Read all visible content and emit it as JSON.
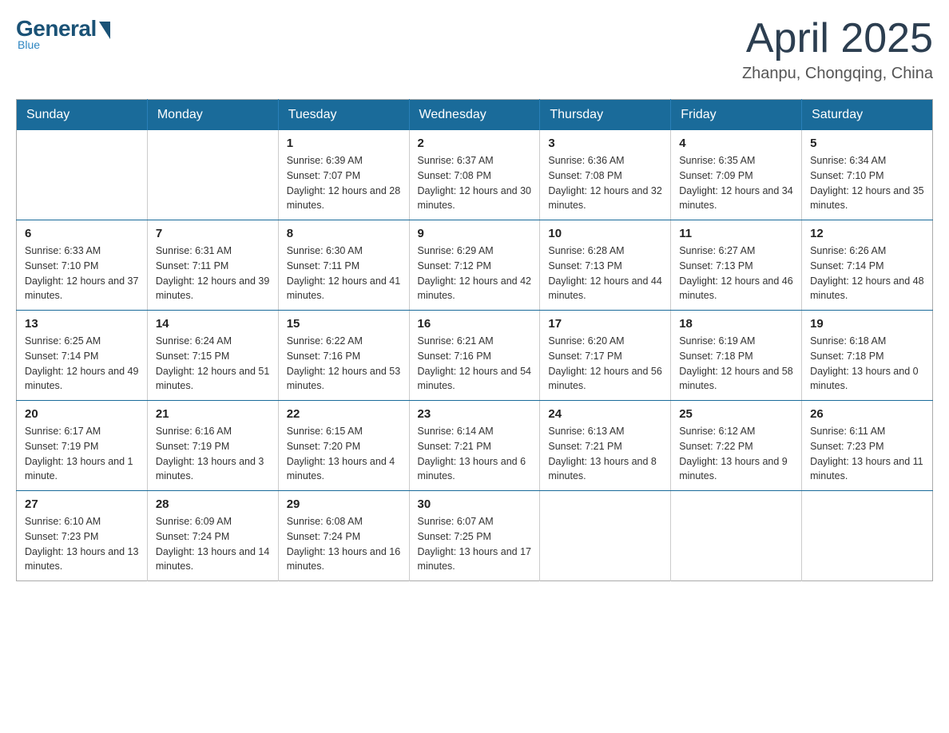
{
  "logo": {
    "general": "General",
    "blue": "Blue",
    "tagline": "Blue"
  },
  "header": {
    "title": "April 2025",
    "location": "Zhanpu, Chongqing, China"
  },
  "days_of_week": [
    "Sunday",
    "Monday",
    "Tuesday",
    "Wednesday",
    "Thursday",
    "Friday",
    "Saturday"
  ],
  "weeks": [
    [
      {
        "day": "",
        "sunrise": "",
        "sunset": "",
        "daylight": ""
      },
      {
        "day": "",
        "sunrise": "",
        "sunset": "",
        "daylight": ""
      },
      {
        "day": "1",
        "sunrise": "Sunrise: 6:39 AM",
        "sunset": "Sunset: 7:07 PM",
        "daylight": "Daylight: 12 hours and 28 minutes."
      },
      {
        "day": "2",
        "sunrise": "Sunrise: 6:37 AM",
        "sunset": "Sunset: 7:08 PM",
        "daylight": "Daylight: 12 hours and 30 minutes."
      },
      {
        "day": "3",
        "sunrise": "Sunrise: 6:36 AM",
        "sunset": "Sunset: 7:08 PM",
        "daylight": "Daylight: 12 hours and 32 minutes."
      },
      {
        "day": "4",
        "sunrise": "Sunrise: 6:35 AM",
        "sunset": "Sunset: 7:09 PM",
        "daylight": "Daylight: 12 hours and 34 minutes."
      },
      {
        "day": "5",
        "sunrise": "Sunrise: 6:34 AM",
        "sunset": "Sunset: 7:10 PM",
        "daylight": "Daylight: 12 hours and 35 minutes."
      }
    ],
    [
      {
        "day": "6",
        "sunrise": "Sunrise: 6:33 AM",
        "sunset": "Sunset: 7:10 PM",
        "daylight": "Daylight: 12 hours and 37 minutes."
      },
      {
        "day": "7",
        "sunrise": "Sunrise: 6:31 AM",
        "sunset": "Sunset: 7:11 PM",
        "daylight": "Daylight: 12 hours and 39 minutes."
      },
      {
        "day": "8",
        "sunrise": "Sunrise: 6:30 AM",
        "sunset": "Sunset: 7:11 PM",
        "daylight": "Daylight: 12 hours and 41 minutes."
      },
      {
        "day": "9",
        "sunrise": "Sunrise: 6:29 AM",
        "sunset": "Sunset: 7:12 PM",
        "daylight": "Daylight: 12 hours and 42 minutes."
      },
      {
        "day": "10",
        "sunrise": "Sunrise: 6:28 AM",
        "sunset": "Sunset: 7:13 PM",
        "daylight": "Daylight: 12 hours and 44 minutes."
      },
      {
        "day": "11",
        "sunrise": "Sunrise: 6:27 AM",
        "sunset": "Sunset: 7:13 PM",
        "daylight": "Daylight: 12 hours and 46 minutes."
      },
      {
        "day": "12",
        "sunrise": "Sunrise: 6:26 AM",
        "sunset": "Sunset: 7:14 PM",
        "daylight": "Daylight: 12 hours and 48 minutes."
      }
    ],
    [
      {
        "day": "13",
        "sunrise": "Sunrise: 6:25 AM",
        "sunset": "Sunset: 7:14 PM",
        "daylight": "Daylight: 12 hours and 49 minutes."
      },
      {
        "day": "14",
        "sunrise": "Sunrise: 6:24 AM",
        "sunset": "Sunset: 7:15 PM",
        "daylight": "Daylight: 12 hours and 51 minutes."
      },
      {
        "day": "15",
        "sunrise": "Sunrise: 6:22 AM",
        "sunset": "Sunset: 7:16 PM",
        "daylight": "Daylight: 12 hours and 53 minutes."
      },
      {
        "day": "16",
        "sunrise": "Sunrise: 6:21 AM",
        "sunset": "Sunset: 7:16 PM",
        "daylight": "Daylight: 12 hours and 54 minutes."
      },
      {
        "day": "17",
        "sunrise": "Sunrise: 6:20 AM",
        "sunset": "Sunset: 7:17 PM",
        "daylight": "Daylight: 12 hours and 56 minutes."
      },
      {
        "day": "18",
        "sunrise": "Sunrise: 6:19 AM",
        "sunset": "Sunset: 7:18 PM",
        "daylight": "Daylight: 12 hours and 58 minutes."
      },
      {
        "day": "19",
        "sunrise": "Sunrise: 6:18 AM",
        "sunset": "Sunset: 7:18 PM",
        "daylight": "Daylight: 13 hours and 0 minutes."
      }
    ],
    [
      {
        "day": "20",
        "sunrise": "Sunrise: 6:17 AM",
        "sunset": "Sunset: 7:19 PM",
        "daylight": "Daylight: 13 hours and 1 minute."
      },
      {
        "day": "21",
        "sunrise": "Sunrise: 6:16 AM",
        "sunset": "Sunset: 7:19 PM",
        "daylight": "Daylight: 13 hours and 3 minutes."
      },
      {
        "day": "22",
        "sunrise": "Sunrise: 6:15 AM",
        "sunset": "Sunset: 7:20 PM",
        "daylight": "Daylight: 13 hours and 4 minutes."
      },
      {
        "day": "23",
        "sunrise": "Sunrise: 6:14 AM",
        "sunset": "Sunset: 7:21 PM",
        "daylight": "Daylight: 13 hours and 6 minutes."
      },
      {
        "day": "24",
        "sunrise": "Sunrise: 6:13 AM",
        "sunset": "Sunset: 7:21 PM",
        "daylight": "Daylight: 13 hours and 8 minutes."
      },
      {
        "day": "25",
        "sunrise": "Sunrise: 6:12 AM",
        "sunset": "Sunset: 7:22 PM",
        "daylight": "Daylight: 13 hours and 9 minutes."
      },
      {
        "day": "26",
        "sunrise": "Sunrise: 6:11 AM",
        "sunset": "Sunset: 7:23 PM",
        "daylight": "Daylight: 13 hours and 11 minutes."
      }
    ],
    [
      {
        "day": "27",
        "sunrise": "Sunrise: 6:10 AM",
        "sunset": "Sunset: 7:23 PM",
        "daylight": "Daylight: 13 hours and 13 minutes."
      },
      {
        "day": "28",
        "sunrise": "Sunrise: 6:09 AM",
        "sunset": "Sunset: 7:24 PM",
        "daylight": "Daylight: 13 hours and 14 minutes."
      },
      {
        "day": "29",
        "sunrise": "Sunrise: 6:08 AM",
        "sunset": "Sunset: 7:24 PM",
        "daylight": "Daylight: 13 hours and 16 minutes."
      },
      {
        "day": "30",
        "sunrise": "Sunrise: 6:07 AM",
        "sunset": "Sunset: 7:25 PM",
        "daylight": "Daylight: 13 hours and 17 minutes."
      },
      {
        "day": "",
        "sunrise": "",
        "sunset": "",
        "daylight": ""
      },
      {
        "day": "",
        "sunrise": "",
        "sunset": "",
        "daylight": ""
      },
      {
        "day": "",
        "sunrise": "",
        "sunset": "",
        "daylight": ""
      }
    ]
  ]
}
